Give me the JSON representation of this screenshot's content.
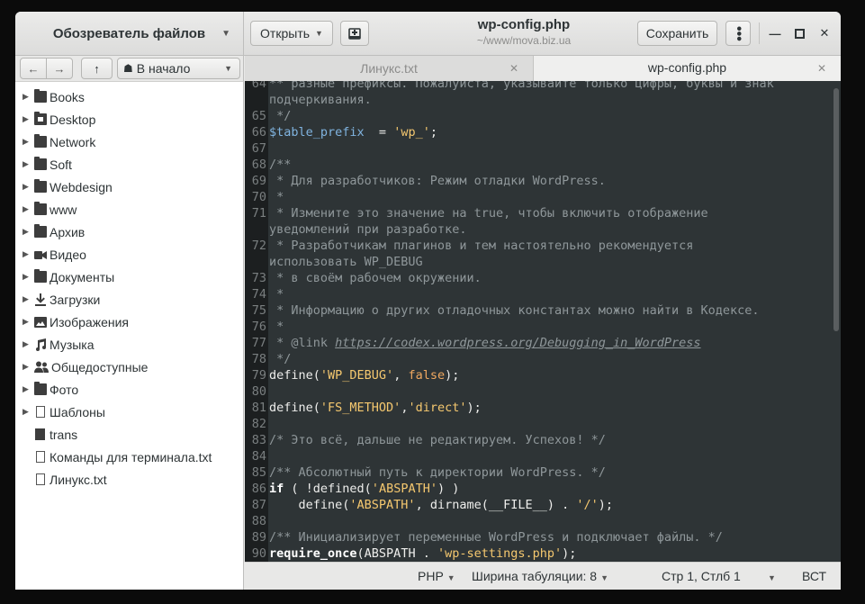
{
  "sidebar": {
    "title": "Обозреватель файлов",
    "location": "В начало",
    "items": [
      {
        "label": "Books",
        "icon": "folder-icon",
        "expandable": true
      },
      {
        "label": "Desktop",
        "icon": "desktop-folder-icon",
        "expandable": true
      },
      {
        "label": "Network",
        "icon": "folder-icon",
        "expandable": true
      },
      {
        "label": "Soft",
        "icon": "folder-icon",
        "expandable": true
      },
      {
        "label": "Webdesign",
        "icon": "folder-icon",
        "expandable": true
      },
      {
        "label": "www",
        "icon": "folder-icon",
        "expandable": true
      },
      {
        "label": "Архив",
        "icon": "folder-icon",
        "expandable": true
      },
      {
        "label": "Видео",
        "icon": "video-icon",
        "expandable": true
      },
      {
        "label": "Документы",
        "icon": "folder-icon",
        "expandable": true
      },
      {
        "label": "Загрузки",
        "icon": "download-icon",
        "expandable": true
      },
      {
        "label": "Изображения",
        "icon": "image-icon",
        "expandable": true
      },
      {
        "label": "Музыка",
        "icon": "music-icon",
        "expandable": true
      },
      {
        "label": "Общедоступные",
        "icon": "people-icon",
        "expandable": true
      },
      {
        "label": "Фото",
        "icon": "folder-icon",
        "expandable": true
      },
      {
        "label": "Шаблоны",
        "icon": "template-icon",
        "expandable": true
      },
      {
        "label": "trans",
        "icon": "file-icon",
        "expandable": false
      },
      {
        "label": "Команды для терминала.txt",
        "icon": "text-file-icon",
        "expandable": false
      },
      {
        "label": "Линукс.txt",
        "icon": "text-file-icon",
        "expandable": false
      }
    ]
  },
  "header": {
    "open_label": "Открыть",
    "save_label": "Сохранить",
    "title": "wp-config.php",
    "subtitle": "~/www/mova.biz.ua"
  },
  "tabs": [
    {
      "label": "Линукс.txt",
      "active": false
    },
    {
      "label": "wp-config.php",
      "active": true
    }
  ],
  "editor": {
    "lines": [
      {
        "n": "64",
        "t": "** разные префиксы. Пожалуйста, указывайте только цифры, буквы и знак"
      },
      {
        "n": "",
        "t": "подчеркивания."
      },
      {
        "n": "65",
        "t": " */"
      },
      {
        "n": "66",
        "t": "$table_prefix  = 'wp_';"
      },
      {
        "n": "67",
        "t": ""
      },
      {
        "n": "68",
        "t": "/**"
      },
      {
        "n": "69",
        "t": " * Для разработчиков: Режим отладки WordPress."
      },
      {
        "n": "70",
        "t": " *"
      },
      {
        "n": "71",
        "t": " * Измените это значение на true, чтобы включить отображение"
      },
      {
        "n": "",
        "t": "уведомлений при разработке."
      },
      {
        "n": "72",
        "t": " * Разработчикам плагинов и тем настоятельно рекомендуется"
      },
      {
        "n": "",
        "t": "использовать WP_DEBUG"
      },
      {
        "n": "73",
        "t": " * в своём рабочем окружении."
      },
      {
        "n": "74",
        "t": " *"
      },
      {
        "n": "75",
        "t": " * Информацию о других отладочных константах можно найти в Кодексе."
      },
      {
        "n": "76",
        "t": " *"
      },
      {
        "n": "77",
        "t": " * @link https://codex.wordpress.org/Debugging_in_WordPress"
      },
      {
        "n": "78",
        "t": " */"
      },
      {
        "n": "79",
        "t": "define('WP_DEBUG', false);"
      },
      {
        "n": "80",
        "t": ""
      },
      {
        "n": "81",
        "t": "define('FS_METHOD','direct');"
      },
      {
        "n": "82",
        "t": ""
      },
      {
        "n": "83",
        "t": "/* Это всё, дальше не редактируем. Успехов! */"
      },
      {
        "n": "84",
        "t": ""
      },
      {
        "n": "85",
        "t": "/** Абсолютный путь к директории WordPress. */"
      },
      {
        "n": "86",
        "t": "if ( !defined('ABSPATH') )"
      },
      {
        "n": "87",
        "t": "    define('ABSPATH', dirname(__FILE__) . '/');"
      },
      {
        "n": "88",
        "t": ""
      },
      {
        "n": "89",
        "t": "/** Инициализирует переменные WordPress и подключает файлы. */"
      },
      {
        "n": "90",
        "t": "require_once(ABSPATH . 'wp-settings.php');"
      }
    ]
  },
  "status": {
    "language": "PHP",
    "tab_width": "Ширина табуляции: 8",
    "position": "Стр 1, Стлб 1",
    "mode": "ВСТ"
  }
}
